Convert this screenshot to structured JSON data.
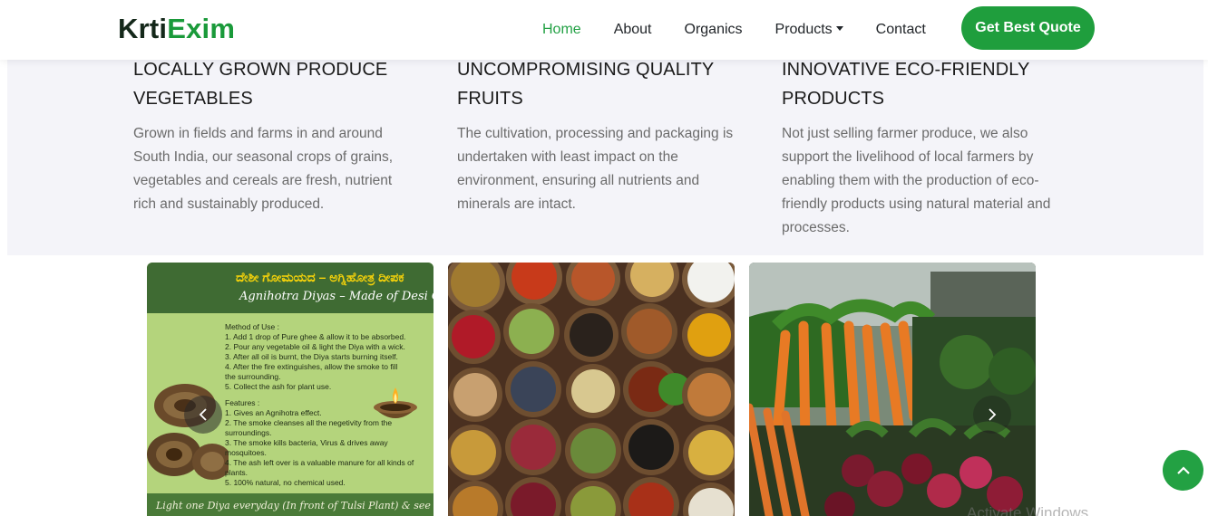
{
  "brand": {
    "part1": "Krti",
    "part2": "Exim"
  },
  "nav": {
    "home": "Home",
    "about": "About",
    "organics": "Organics",
    "products": "Products",
    "contact": "Contact",
    "cta": "Get Best Quote"
  },
  "features": [
    {
      "title_line1": "LOCALLY GROWN PRODUCE",
      "title_line2": "VEGETABLES",
      "body": "Grown in fields and farms in and around South India, our seasonal crops of grains, vegetables and cereals are fresh, nutrient rich and sustainably produced."
    },
    {
      "title_line1": "UNCOMPROMISING QUALITY",
      "title_line2": "FRUITS",
      "body": "The cultivation, processing and packaging is undertaken with least impact on the environment, ensuring all nutrients and minerals are intact."
    },
    {
      "title_line1": "INNOVATIVE ECO-FRIENDLY",
      "title_line2": "PRODUCTS",
      "body": "Not just selling farmer produce, we also support the livelihood of local farmers by enabling them with the production of eco-friendly products using natural material and processes."
    }
  ],
  "carousel": {
    "diya": {
      "title_kannada": "ದೇಶೀ ಗೋಮಯದ – ಅಗ್ನಿಹೋತ್ರ ದೀಪಕ",
      "title": "Agnihotra Diyas – Made of Desi Cowdung",
      "method_heading": "Method of Use :",
      "method": [
        "1. Add 1 drop of Pure ghee & allow it to be absorbed.",
        "2. Pour any vegetable oil & light the Diya with a wick.",
        "3. After all oil is burnt, the Diya starts burning itself.",
        "4. After the fire extinguishes, allow the smoke to fill",
        "the surrounding.",
        "5. Collect the ash for plant use."
      ],
      "features_heading": "Features :",
      "features": [
        "1. Gives an Agnihotra effect.",
        "2. The smoke cleanses all the negetivity from the surroundings.",
        "3. The smoke kills bacteria, Virus & drives away mosquitoes.",
        "4. The ash left over is a valuable manure for all kinds of plants.",
        "5. 100% natural, no chemical used."
      ],
      "footer": "Light one Diya everyday (In front of Tulsi Plant) & see the positivity"
    }
  },
  "watermark": "Activate Windows",
  "colors": {
    "brand_green": "#1f9e3d",
    "active_link": "#22a144",
    "feature_bg": "#f4f4f9"
  },
  "icons": {
    "prev": "chevron-left-icon",
    "next": "chevron-right-icon",
    "scroll_top": "chevron-up-icon"
  }
}
